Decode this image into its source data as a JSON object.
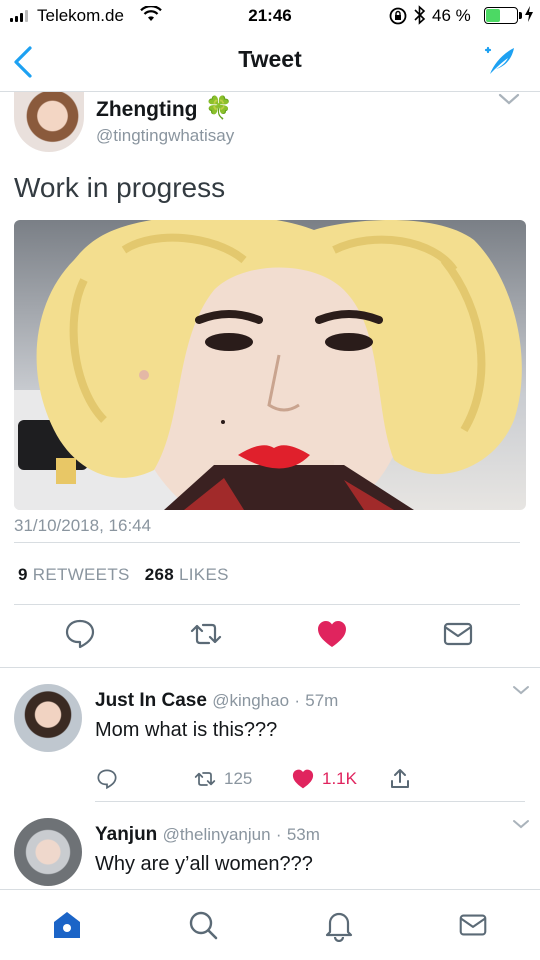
{
  "status_bar": {
    "carrier": "Telekom.de",
    "time": "21:46",
    "battery_percent": "46 %",
    "battery_level": 0.46
  },
  "nav": {
    "title": "Tweet",
    "back_icon": "chevron-left-icon",
    "compose_icon": "compose-tweet-icon"
  },
  "tweet": {
    "author_name": "Zhengting",
    "author_emoji": "🍀",
    "author_handle": "@tingtingwhatisay",
    "text": "Work in progress",
    "timestamp": "31/10/2018, 16:44",
    "retweets_count": "9",
    "retweets_label": "RETWEETS",
    "likes_count": "268",
    "likes_label": "LIKES",
    "liked": true
  },
  "replies": [
    {
      "name": "Just In Case",
      "handle": "@kinghao",
      "time": "57m",
      "text": "Mom what is this???",
      "retweets": "125",
      "likes": "1.1K",
      "liked": true
    },
    {
      "name": "Yanjun",
      "handle": "@thelinyanjun",
      "time": "53m",
      "text": "Why are y’all women???"
    }
  ],
  "colors": {
    "accent": "#1da1f2",
    "like": "#e0245e",
    "muted": "#8a959f",
    "nav_active": "#1b64c7"
  }
}
